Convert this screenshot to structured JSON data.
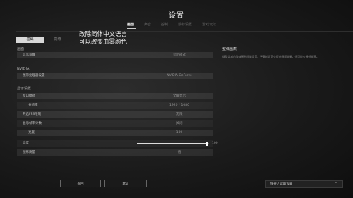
{
  "title": "设置",
  "tabs": [
    {
      "label": "画面",
      "active": true
    },
    {
      "label": "声音"
    },
    {
      "label": "控制"
    },
    {
      "label": "鼠标设置"
    },
    {
      "label": "游戏玩法"
    }
  ],
  "subtabs": [
    {
      "label": "基础",
      "active": true
    },
    {
      "label": "高级"
    }
  ],
  "annotation": {
    "line1": "改除简体中文语言",
    "line2": "可以改变血雾颜色"
  },
  "sections": {
    "a": "画面",
    "b": "NVIDIA",
    "c": "显示设置"
  },
  "rows": {
    "r1": {
      "label": "显示设置",
      "value": "显示模式"
    },
    "r2": {
      "label": "图形处理器设置",
      "value": "NVIDIA GeForce"
    },
    "r3": {
      "label": "窗口模式",
      "value": "全屏显示"
    },
    "r4": {
      "label": "分辨率",
      "value": "1920 * 1080"
    },
    "r5": {
      "label": "开启FPS限制",
      "value": "无限"
    },
    "r6": {
      "label": "显示帧率计数",
      "value": "关闭"
    },
    "r7": {
      "label": "亮度",
      "value": "100"
    },
    "r8": {
      "label": "亮度",
      "value": "100"
    },
    "r9": {
      "label": "图形质量",
      "value": "低"
    }
  },
  "slider": {
    "level_percent": 97
  },
  "info": {
    "title": "整体画质",
    "desc": "调整游戏的整体图形质量设置。更高的设置会提升画面效果，但可能会降低帧率。"
  },
  "footer": {
    "faint_text": "",
    "back_label": "返回",
    "default_label": "默认",
    "save_label": "保存 / 读取设置"
  }
}
